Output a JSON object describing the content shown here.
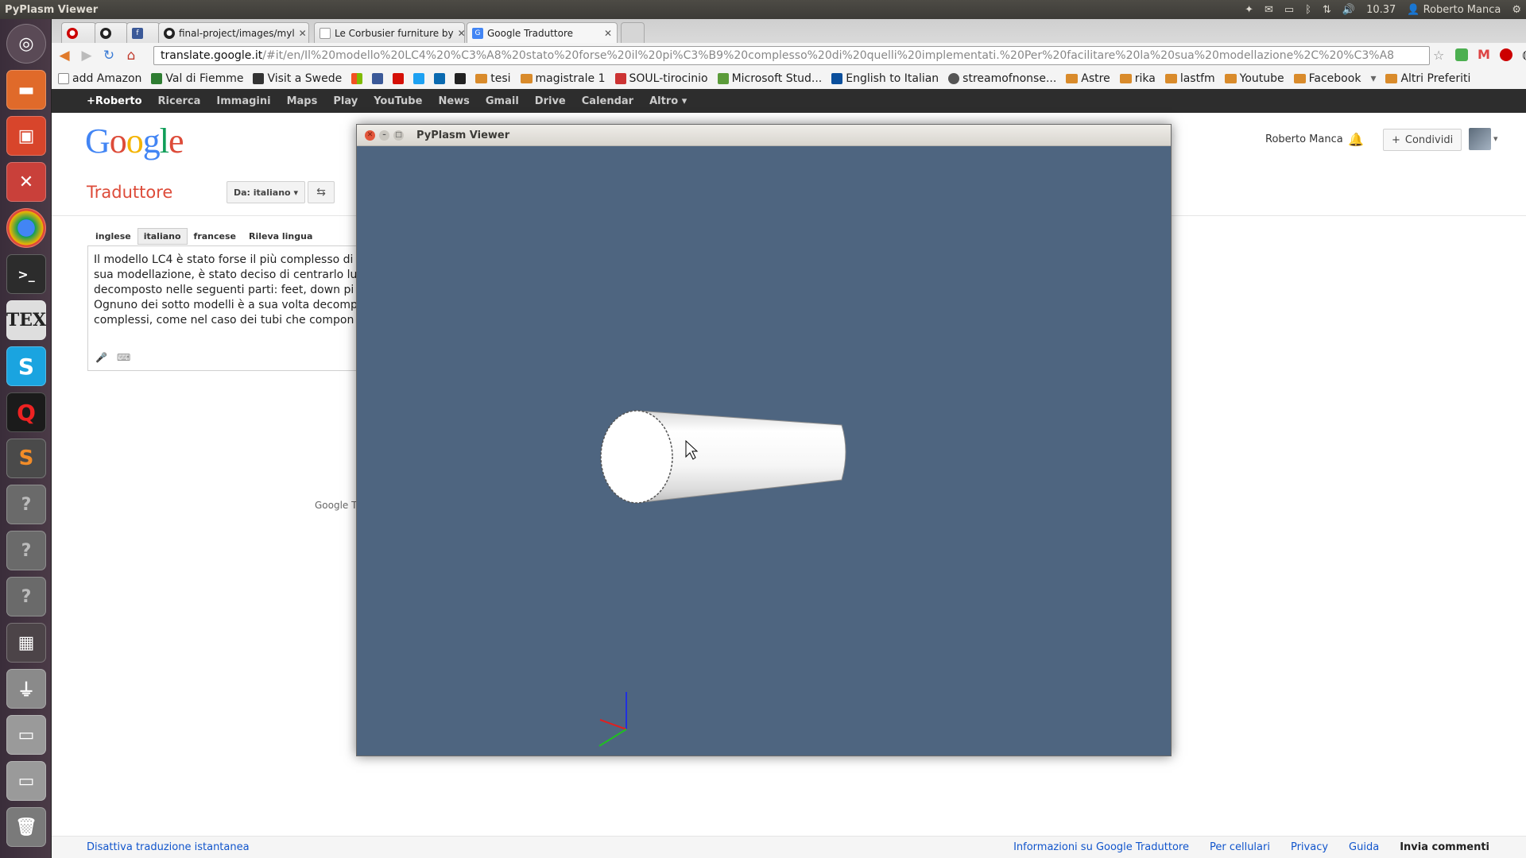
{
  "topbar": {
    "title": "PyPlasm Viewer",
    "time": "10.37",
    "user": "Roberto Manca"
  },
  "browser": {
    "tabs": [
      {
        "label": "final-project/images/myl"
      },
      {
        "label": "Le Corbusier furniture by"
      },
      {
        "label": "Google Traduttore"
      }
    ],
    "url_host": "translate.google.it",
    "url_path": "/#it/en/Il%20modello%20LC4%20%C3%A8%20stato%20forse%20il%20pi%C3%B9%20complesso%20di%20quelli%20implementati.%20Per%20facilitare%20la%20sua%20modellazione%2C%20%C3%A8",
    "bookmarks": [
      "add Amazon",
      "Val di Fiemme",
      "Visit a Swede",
      "tesi",
      "magistrale 1",
      "SOUL-tirocinio",
      "Microsoft Stud...",
      "English to Italian",
      "streamofnonse...",
      "Astre",
      "rika",
      "lastfm",
      "Youtube",
      "Facebook"
    ],
    "bookmarks_more": "Altri Preferiti"
  },
  "gbar": [
    "+Roberto",
    "Ricerca",
    "Immagini",
    "Maps",
    "Play",
    "YouTube",
    "News",
    "Gmail",
    "Drive",
    "Calendar",
    "Altro ▾"
  ],
  "header": {
    "logo": "Google",
    "title": "Traduttore",
    "from_lang": "Da: italiano",
    "user": "Roberto Manca",
    "share": "Condividi"
  },
  "translate": {
    "lang_tabs": [
      "inglese",
      "italiano",
      "francese",
      "Rileva lingua"
    ],
    "source_lines": [
      "Il modello LC4 è stato forse il più complesso di",
      "sua modellazione, è stato deciso di centrarlo lu",
      "decomposto nelle seguenti parti:  feet, down pi",
      "Ognuno dei sotto modelli è a sua volta decomp",
      "complessi, come nel caso dei tubi che compon"
    ],
    "footer_partial": "Google T"
  },
  "footer": {
    "left": "Disattiva traduzione istantanea",
    "links": [
      "Informazioni su Google Traduttore",
      "Per cellulari",
      "Privacy",
      "Guida",
      "Invia commenti"
    ]
  },
  "viewer": {
    "title": "PyPlasm Viewer",
    "bg_color": "#4e6580"
  },
  "colors": {
    "google_blue": "#4285f4",
    "google_red": "#dd4b39",
    "google_yellow": "#f4b400",
    "google_green": "#0f9d58",
    "axis_x": "#e02020",
    "axis_y": "#20c020",
    "axis_z": "#2030e0"
  }
}
